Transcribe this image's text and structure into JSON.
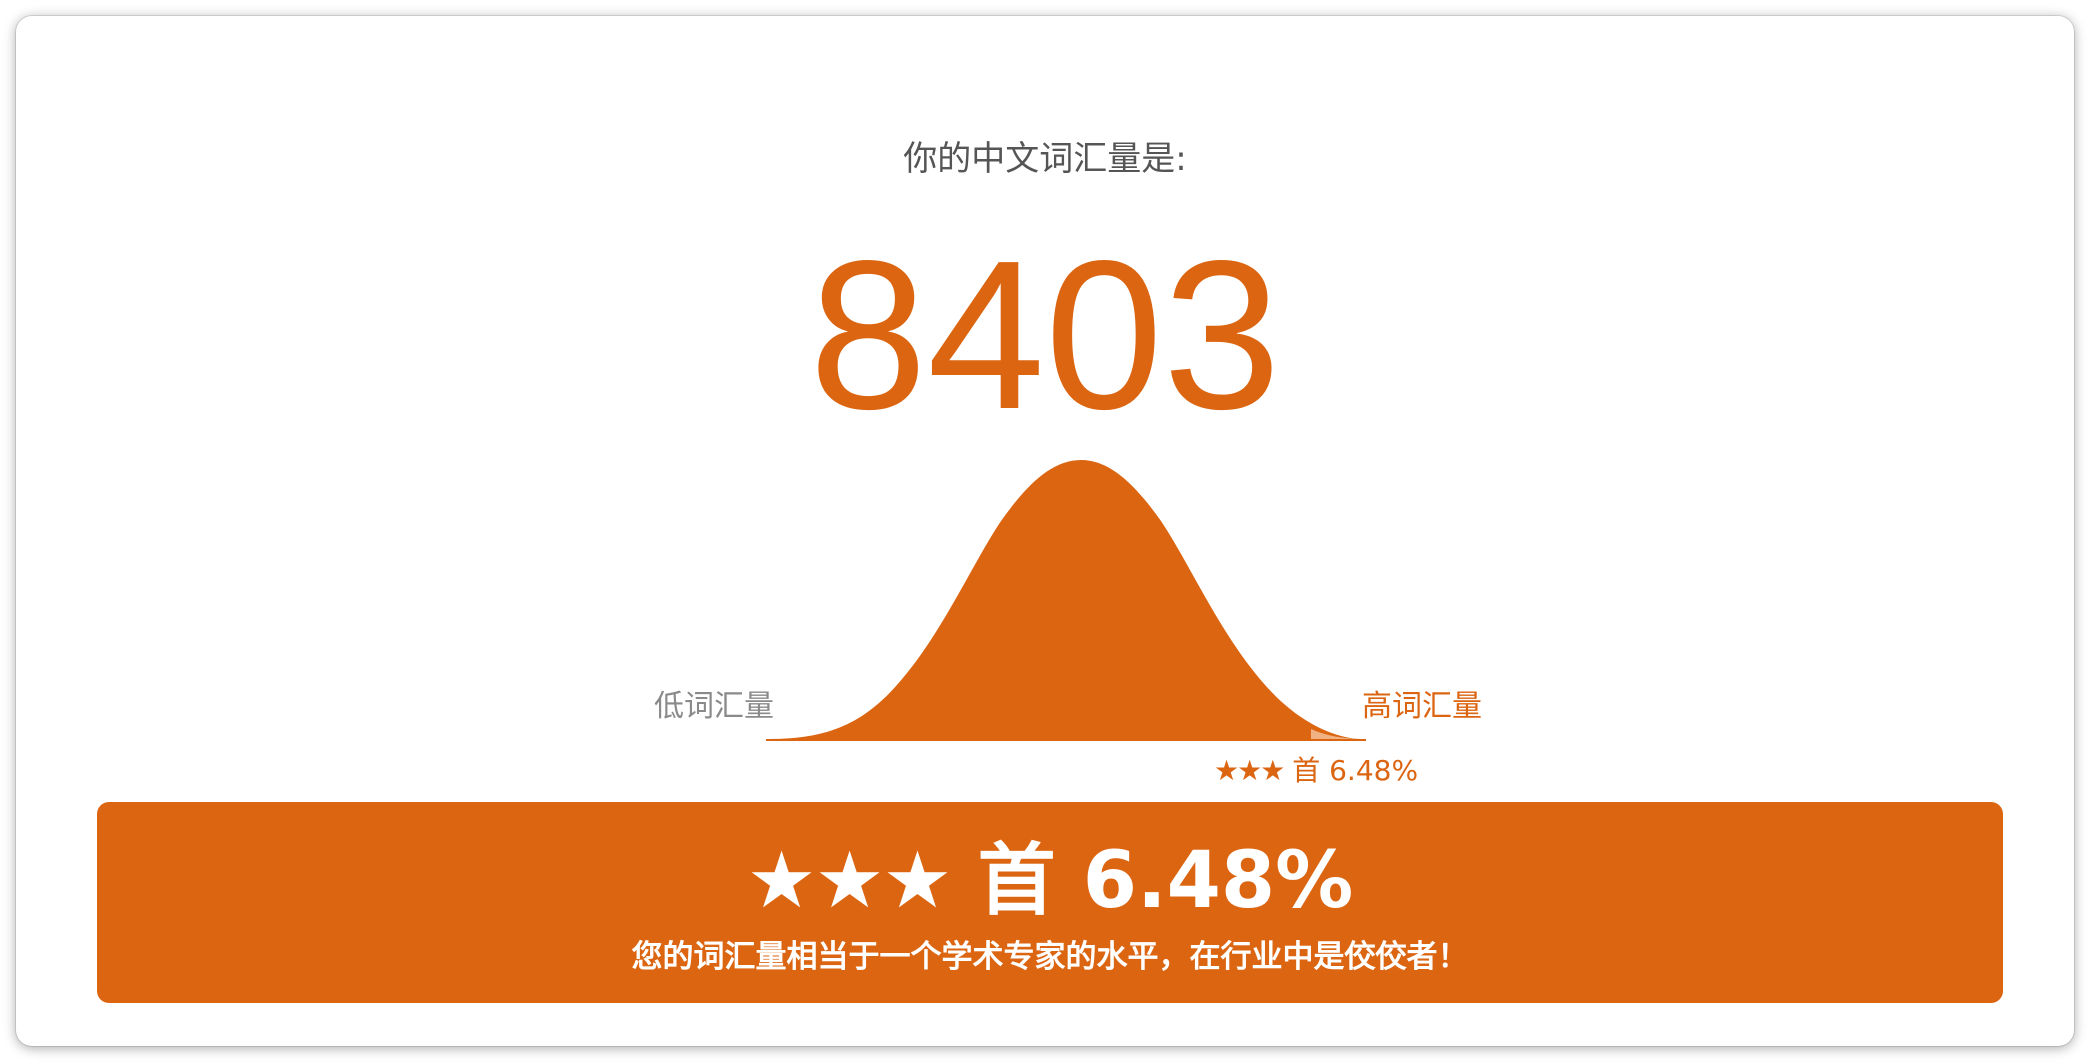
{
  "result": {
    "intro": "你的中文词汇量是:",
    "score": "8403"
  },
  "distribution": {
    "low_label": "低词汇量",
    "high_label": "高词汇量",
    "marker": {
      "stars": "★★★",
      "text": "首 6.48%",
      "percent": 6.48
    },
    "color": "#dc6511"
  },
  "banner": {
    "stars": "★★★",
    "headline": "首 6.48%",
    "message": "您的词汇量相当于一个学术专家的水平，在行业中是佼佼者！",
    "color": "#dc6511"
  }
}
